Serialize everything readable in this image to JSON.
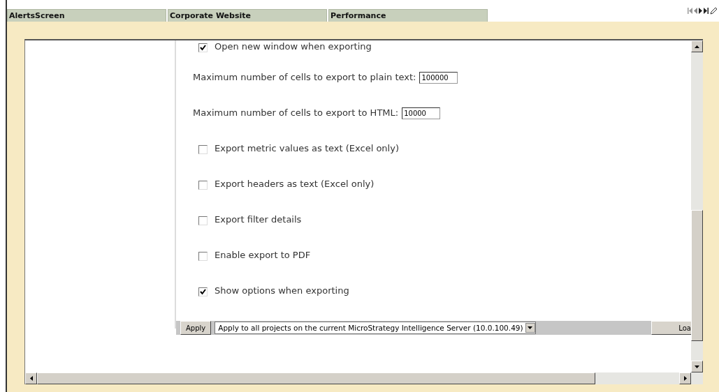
{
  "tabs": [
    {
      "label": "AlertsScreen",
      "selected": false
    },
    {
      "label": "Corporate Website",
      "selected": false
    },
    {
      "label": "Performance",
      "selected": false
    }
  ],
  "options": [
    {
      "kind": "checkbox",
      "label": "Open new window when exporting",
      "checked": true
    },
    {
      "kind": "number",
      "label": "Maximum number of cells to export to plain text:",
      "value": "100000"
    },
    {
      "kind": "number",
      "label": "Maximum number of cells to export to HTML:",
      "value": "10000"
    },
    {
      "kind": "checkbox",
      "label": "Export metric values as text (Excel only)",
      "checked": false
    },
    {
      "kind": "checkbox",
      "label": "Export headers as text (Excel only)",
      "checked": false
    },
    {
      "kind": "checkbox",
      "label": "Export filter details",
      "checked": false
    },
    {
      "kind": "checkbox",
      "label": "Enable export to PDF",
      "checked": false
    },
    {
      "kind": "checkbox",
      "label": "Show options when exporting",
      "checked": true
    }
  ],
  "apply_bar": {
    "apply_button": "Apply",
    "scope": "Apply to all projects on the current MicroStrategy Intelligence Server (10.0.100.49)",
    "load_button": "Loa"
  }
}
